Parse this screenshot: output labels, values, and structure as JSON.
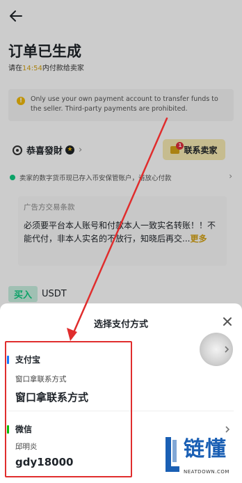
{
  "header": {
    "back_icon": "arrow-left-icon"
  },
  "order": {
    "title": "订单已生成",
    "subtitle_prefix": "请在",
    "countdown": "14:54",
    "subtitle_suffix": "内付款给卖家"
  },
  "notice": {
    "icon": "warning-icon",
    "text": "Only use your own payment account to transfer funds to the seller. Third-party payments are prohibited."
  },
  "merchant": {
    "name": "恭喜發財",
    "contact_label": "联系卖家",
    "unread_count": "1"
  },
  "escrow": {
    "text": "卖家的数字货币现已存入币安保管账户，请放心付款"
  },
  "terms": {
    "title": "广告方交易条款",
    "body": "必须要平台本人账号和付款本人一致实名转账！！不能代付，非本人实名的不放行，知晓后再交...",
    "more": "更多"
  },
  "trade": {
    "side": "买入",
    "coin": "USDT"
  },
  "sheet": {
    "title": "选择支付方式",
    "methods": [
      {
        "name": "支付宝",
        "sub": "窗口拿联系方式",
        "value": "窗口拿联系方式",
        "accent": "#1677ff"
      },
      {
        "name": "微信",
        "sub": "邱明炎",
        "value": "gdy18000",
        "accent": "#09bb07"
      }
    ]
  },
  "watermark": {
    "cn": "链懂",
    "en": "NEATDOWN.COM"
  },
  "colors": {
    "brand_yellow": "#f0b90b",
    "buy_green": "#0ecb81",
    "annotation_red": "#e02d2d"
  }
}
